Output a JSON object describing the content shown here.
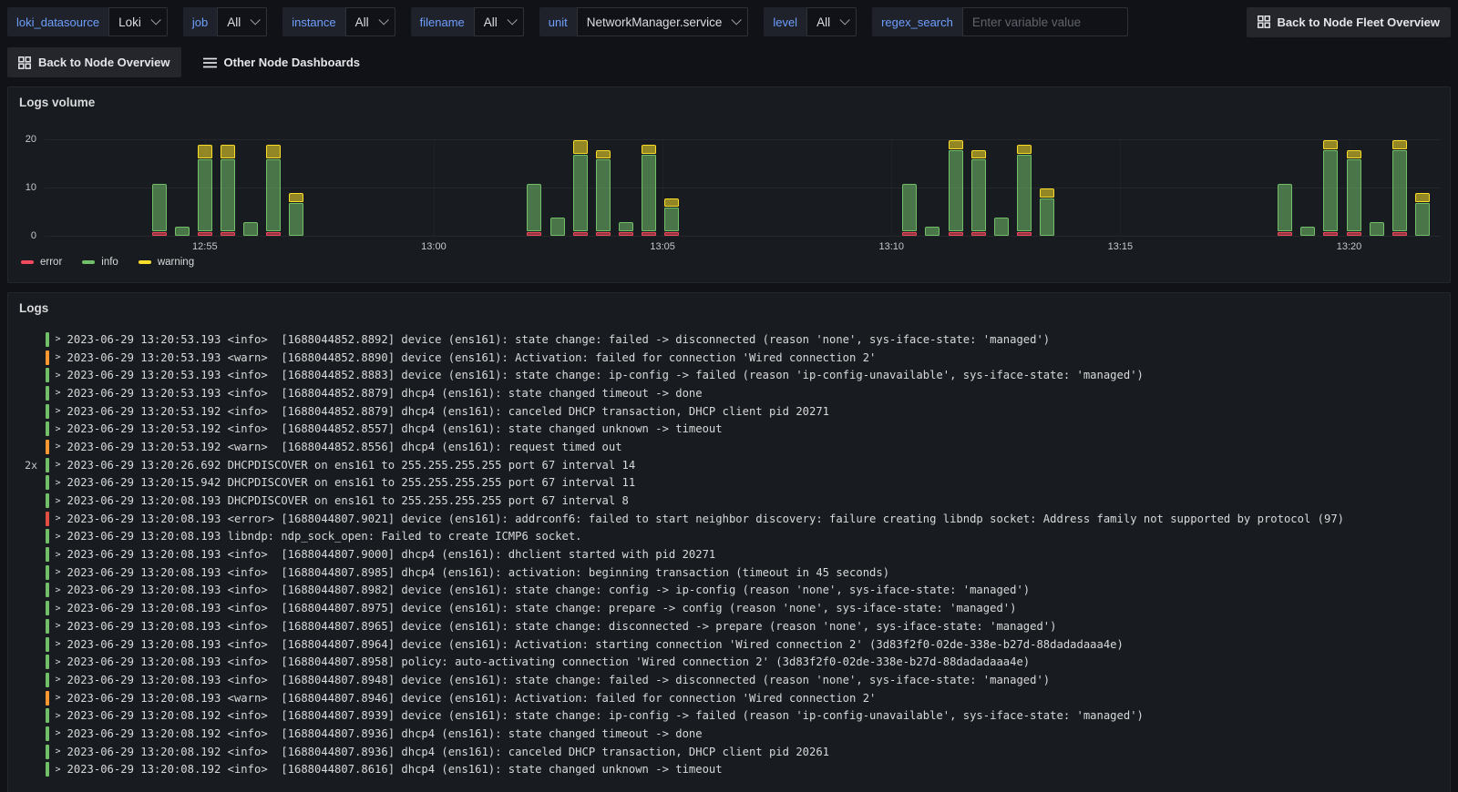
{
  "topbar": {
    "variables": [
      {
        "label": "loki_datasource",
        "value": "Loki",
        "type": "select"
      },
      {
        "label": "job",
        "value": "All",
        "type": "select"
      },
      {
        "label": "instance",
        "value": "All",
        "type": "select"
      },
      {
        "label": "filename",
        "value": "All",
        "type": "select"
      },
      {
        "label": "unit",
        "value": "NetworkManager.service",
        "type": "select"
      },
      {
        "label": "level",
        "value": "All",
        "type": "select"
      },
      {
        "label": "regex_search",
        "value": "",
        "placeholder": "Enter variable value",
        "type": "input"
      }
    ],
    "fleet_button_label": "Back to Node Fleet Overview"
  },
  "nav_row": {
    "back_button_label": "Back to Node Overview",
    "dashboards_label": "Other Node Dashboards"
  },
  "logs_volume_panel": {
    "title": "Logs volume"
  },
  "chart_data": {
    "type": "bar",
    "stacked": true,
    "title": "Logs volume",
    "legend": [
      "error",
      "info",
      "warning"
    ],
    "legend_position": "bottom-left",
    "colors": {
      "error": "#f2495c",
      "info": "#73bf69",
      "warning": "#fade2a"
    },
    "ylim": [
      0,
      20
    ],
    "y_ticks": [
      0,
      10,
      20
    ],
    "x_axis": {
      "start_min": 1.5,
      "end_min": 32.0,
      "origin": "12:50"
    },
    "x_ticks": [
      {
        "minute": 5,
        "label": "12:55"
      },
      {
        "minute": 10,
        "label": "13:00"
      },
      {
        "minute": 15,
        "label": "13:05"
      },
      {
        "minute": 20,
        "label": "13:10"
      },
      {
        "minute": 25,
        "label": "13:15"
      },
      {
        "minute": 30,
        "label": "13:20"
      }
    ],
    "bars": [
      {
        "t": 4.0,
        "error": 1,
        "info": 10,
        "warning": 0
      },
      {
        "t": 4.5,
        "error": 0,
        "info": 2,
        "warning": 0
      },
      {
        "t": 5.0,
        "error": 1,
        "info": 15,
        "warning": 3
      },
      {
        "t": 5.5,
        "error": 1,
        "info": 15,
        "warning": 3
      },
      {
        "t": 6.0,
        "error": 0,
        "info": 3,
        "warning": 0
      },
      {
        "t": 6.5,
        "error": 1,
        "info": 15,
        "warning": 3
      },
      {
        "t": 7.0,
        "error": 0,
        "info": 7,
        "warning": 2
      },
      {
        "t": 12.2,
        "error": 1,
        "info": 10,
        "warning": 0
      },
      {
        "t": 12.7,
        "error": 0,
        "info": 4,
        "warning": 0
      },
      {
        "t": 13.2,
        "error": 1,
        "info": 16,
        "warning": 3
      },
      {
        "t": 13.7,
        "error": 1,
        "info": 15,
        "warning": 2
      },
      {
        "t": 14.2,
        "error": 1,
        "info": 2,
        "warning": 0
      },
      {
        "t": 14.7,
        "error": 1,
        "info": 16,
        "warning": 2
      },
      {
        "t": 15.2,
        "error": 1,
        "info": 5,
        "warning": 2
      },
      {
        "t": 20.4,
        "error": 1,
        "info": 10,
        "warning": 0
      },
      {
        "t": 20.9,
        "error": 0,
        "info": 2,
        "warning": 0
      },
      {
        "t": 21.4,
        "error": 1,
        "info": 17,
        "warning": 2
      },
      {
        "t": 21.9,
        "error": 1,
        "info": 15,
        "warning": 2
      },
      {
        "t": 22.4,
        "error": 0,
        "info": 4,
        "warning": 0
      },
      {
        "t": 22.9,
        "error": 1,
        "info": 16,
        "warning": 2
      },
      {
        "t": 23.4,
        "error": 0,
        "info": 8,
        "warning": 2
      },
      {
        "t": 28.6,
        "error": 1,
        "info": 10,
        "warning": 0
      },
      {
        "t": 29.1,
        "error": 0,
        "info": 2,
        "warning": 0
      },
      {
        "t": 29.6,
        "error": 1,
        "info": 17,
        "warning": 2
      },
      {
        "t": 30.1,
        "error": 1,
        "info": 15,
        "warning": 2
      },
      {
        "t": 30.6,
        "error": 0,
        "info": 3,
        "warning": 0
      },
      {
        "t": 31.1,
        "error": 1,
        "info": 17,
        "warning": 2
      },
      {
        "t": 31.6,
        "error": 0,
        "info": 7,
        "warning": 2
      }
    ]
  },
  "logs_panel": {
    "title": "Logs",
    "level_colors": {
      "info": "#73bf69",
      "warn": "#ff9830",
      "error": "#e24d42"
    },
    "rows": [
      {
        "dup": "",
        "level": "info",
        "text": "2023-06-29 13:20:53.193 <info>  [1688044852.8892] device (ens161): state change: failed -> disconnected (reason 'none', sys-iface-state: 'managed')"
      },
      {
        "dup": "",
        "level": "warn",
        "text": "2023-06-29 13:20:53.193 <warn>  [1688044852.8890] device (ens161): Activation: failed for connection 'Wired connection 2'"
      },
      {
        "dup": "",
        "level": "info",
        "text": "2023-06-29 13:20:53.193 <info>  [1688044852.8883] device (ens161): state change: ip-config -> failed (reason 'ip-config-unavailable', sys-iface-state: 'managed')"
      },
      {
        "dup": "",
        "level": "info",
        "text": "2023-06-29 13:20:53.193 <info>  [1688044852.8879] dhcp4 (ens161): state changed timeout -> done"
      },
      {
        "dup": "",
        "level": "info",
        "text": "2023-06-29 13:20:53.192 <info>  [1688044852.8879] dhcp4 (ens161): canceled DHCP transaction, DHCP client pid 20271"
      },
      {
        "dup": "",
        "level": "info",
        "text": "2023-06-29 13:20:53.192 <info>  [1688044852.8557] dhcp4 (ens161): state changed unknown -> timeout"
      },
      {
        "dup": "",
        "level": "warn",
        "text": "2023-06-29 13:20:53.192 <warn>  [1688044852.8556] dhcp4 (ens161): request timed out"
      },
      {
        "dup": "2x",
        "level": "info",
        "text": "2023-06-29 13:20:26.692 DHCPDISCOVER on ens161 to 255.255.255.255 port 67 interval 14"
      },
      {
        "dup": "",
        "level": "info",
        "text": "2023-06-29 13:20:15.942 DHCPDISCOVER on ens161 to 255.255.255.255 port 67 interval 11"
      },
      {
        "dup": "",
        "level": "info",
        "text": "2023-06-29 13:20:08.193 DHCPDISCOVER on ens161 to 255.255.255.255 port 67 interval 8"
      },
      {
        "dup": "",
        "level": "error",
        "text": "2023-06-29 13:20:08.193 <error> [1688044807.9021] device (ens161): addrconf6: failed to start neighbor discovery: failure creating libndp socket: Address family not supported by protocol (97)"
      },
      {
        "dup": "",
        "level": "info",
        "text": "2023-06-29 13:20:08.193 libndp: ndp_sock_open: Failed to create ICMP6 socket."
      },
      {
        "dup": "",
        "level": "info",
        "text": "2023-06-29 13:20:08.193 <info>  [1688044807.9000] dhcp4 (ens161): dhclient started with pid 20271"
      },
      {
        "dup": "",
        "level": "info",
        "text": "2023-06-29 13:20:08.193 <info>  [1688044807.8985] dhcp4 (ens161): activation: beginning transaction (timeout in 45 seconds)"
      },
      {
        "dup": "",
        "level": "info",
        "text": "2023-06-29 13:20:08.193 <info>  [1688044807.8982] device (ens161): state change: config -> ip-config (reason 'none', sys-iface-state: 'managed')"
      },
      {
        "dup": "",
        "level": "info",
        "text": "2023-06-29 13:20:08.193 <info>  [1688044807.8975] device (ens161): state change: prepare -> config (reason 'none', sys-iface-state: 'managed')"
      },
      {
        "dup": "",
        "level": "info",
        "text": "2023-06-29 13:20:08.193 <info>  [1688044807.8965] device (ens161): state change: disconnected -> prepare (reason 'none', sys-iface-state: 'managed')"
      },
      {
        "dup": "",
        "level": "info",
        "text": "2023-06-29 13:20:08.193 <info>  [1688044807.8964] device (ens161): Activation: starting connection 'Wired connection 2' (3d83f2f0-02de-338e-b27d-88dadadaaa4e)"
      },
      {
        "dup": "",
        "level": "info",
        "text": "2023-06-29 13:20:08.193 <info>  [1688044807.8958] policy: auto-activating connection 'Wired connection 2' (3d83f2f0-02de-338e-b27d-88dadadaaa4e)"
      },
      {
        "dup": "",
        "level": "info",
        "text": "2023-06-29 13:20:08.193 <info>  [1688044807.8948] device (ens161): state change: failed -> disconnected (reason 'none', sys-iface-state: 'managed')"
      },
      {
        "dup": "",
        "level": "warn",
        "text": "2023-06-29 13:20:08.193 <warn>  [1688044807.8946] device (ens161): Activation: failed for connection 'Wired connection 2'"
      },
      {
        "dup": "",
        "level": "info",
        "text": "2023-06-29 13:20:08.192 <info>  [1688044807.8939] device (ens161): state change: ip-config -> failed (reason 'ip-config-unavailable', sys-iface-state: 'managed')"
      },
      {
        "dup": "",
        "level": "info",
        "text": "2023-06-29 13:20:08.192 <info>  [1688044807.8936] dhcp4 (ens161): state changed timeout -> done"
      },
      {
        "dup": "",
        "level": "info",
        "text": "2023-06-29 13:20:08.192 <info>  [1688044807.8936] dhcp4 (ens161): canceled DHCP transaction, DHCP client pid 20261"
      },
      {
        "dup": "",
        "level": "info",
        "text": "2023-06-29 13:20:08.192 <info>  [1688044807.8616] dhcp4 (ens161): state changed unknown -> timeout"
      }
    ]
  }
}
